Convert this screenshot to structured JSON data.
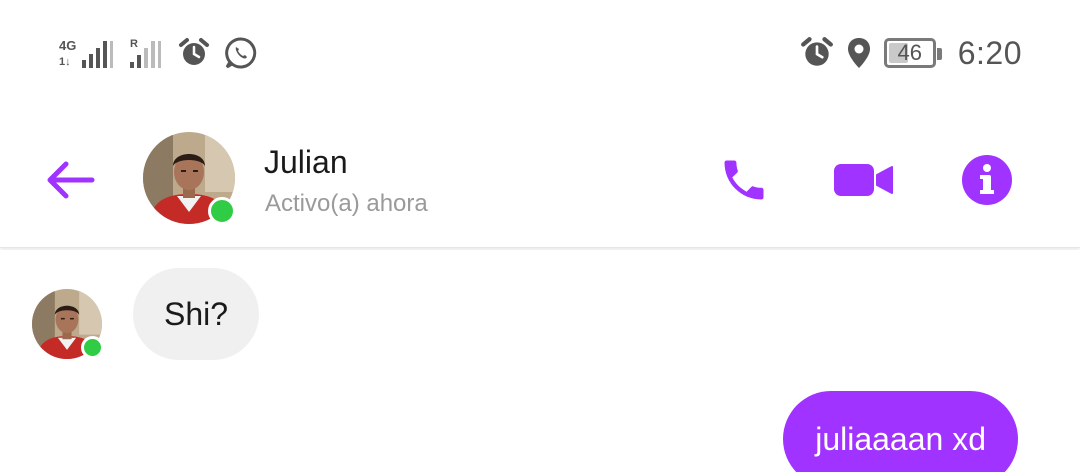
{
  "status_bar": {
    "network_label": "4G",
    "roaming_label": "R",
    "battery_level": "46",
    "battery_fraction": 0.46,
    "time": "6:20",
    "icons": [
      "signal-4g-icon",
      "signal-roaming-icon",
      "alarm-icon",
      "whatsapp-icon",
      "alarm-icon",
      "location-icon",
      "battery-icon"
    ]
  },
  "header": {
    "contact_name": "Julian",
    "contact_status": "Activo(a) ahora",
    "back_icon": "back-arrow-icon",
    "actions": [
      "phone-icon",
      "video-camera-icon",
      "info-icon"
    ]
  },
  "colors": {
    "accent": "#a033ff",
    "online": "#31cc46",
    "incoming_bubble": "#f0f0f0",
    "status_text": "#9a9a9a"
  },
  "messages": [
    {
      "direction": "incoming",
      "text": "Shi?"
    },
    {
      "direction": "outgoing",
      "text": "juliaaaan xd"
    }
  ]
}
